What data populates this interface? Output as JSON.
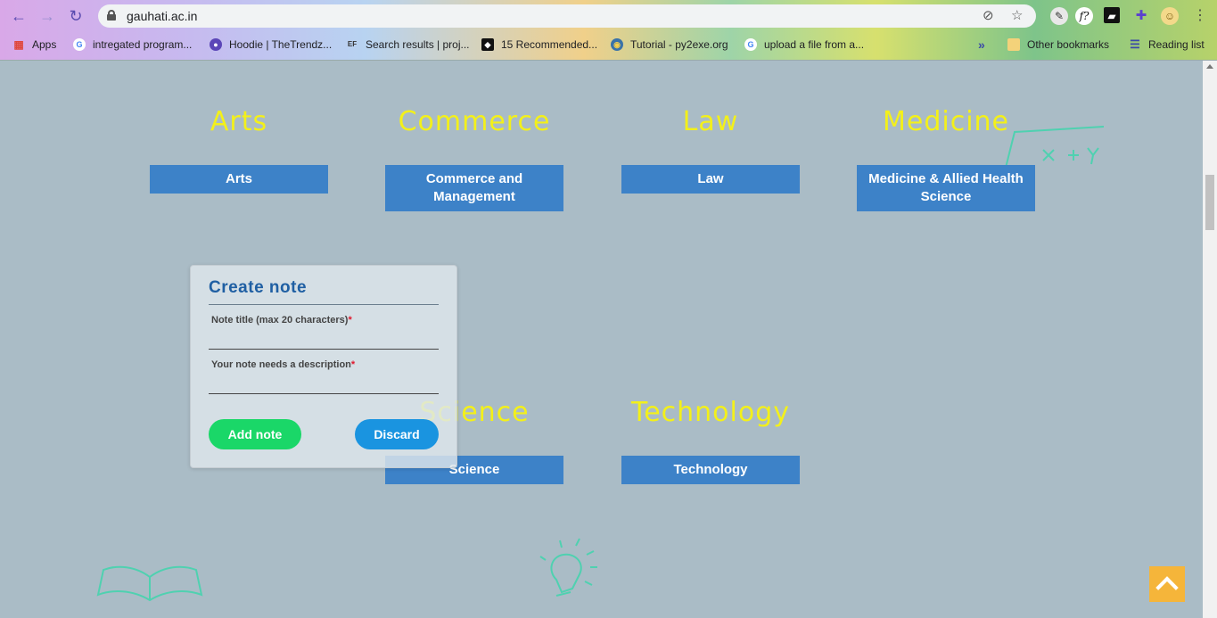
{
  "browser": {
    "url": "gauhati.ac.in",
    "bookmarks": [
      {
        "label": "Apps"
      },
      {
        "label": "intregated program..."
      },
      {
        "label": "Hoodie | TheTrendz..."
      },
      {
        "label": "Search results | proj..."
      },
      {
        "label": "15 Recommended..."
      },
      {
        "label": "Tutorial - py2exe.org"
      },
      {
        "label": "upload a file from a..."
      }
    ],
    "more_label": "»",
    "other_bookmarks": "Other bookmarks",
    "reading_list": "Reading list",
    "ext_fx_label": "f?"
  },
  "streams": [
    {
      "heading": "Arts",
      "button": "Arts"
    },
    {
      "heading": "Commerce",
      "button": "Commerce and Management"
    },
    {
      "heading": "Law",
      "button": "Law"
    },
    {
      "heading": "Medicine",
      "button": "Medicine & Allied Health Science"
    },
    {
      "heading": "Science",
      "button": "Science"
    },
    {
      "heading": "Technology",
      "button": "Technology"
    }
  ],
  "note_modal": {
    "title": "Create note",
    "title_label": "Note title (max 20 characters)",
    "title_value": "",
    "desc_label": "Your note needs a description",
    "desc_value": "",
    "required_mark": "*",
    "add_label": "Add note",
    "discard_label": "Discard"
  },
  "colors": {
    "heading": "#f3f01a",
    "button": "#3d82c8",
    "add_button": "#1ad768",
    "discard_button": "#1a94e0",
    "back_to_top": "#f5b53a",
    "page_background": "#aabcc6"
  }
}
